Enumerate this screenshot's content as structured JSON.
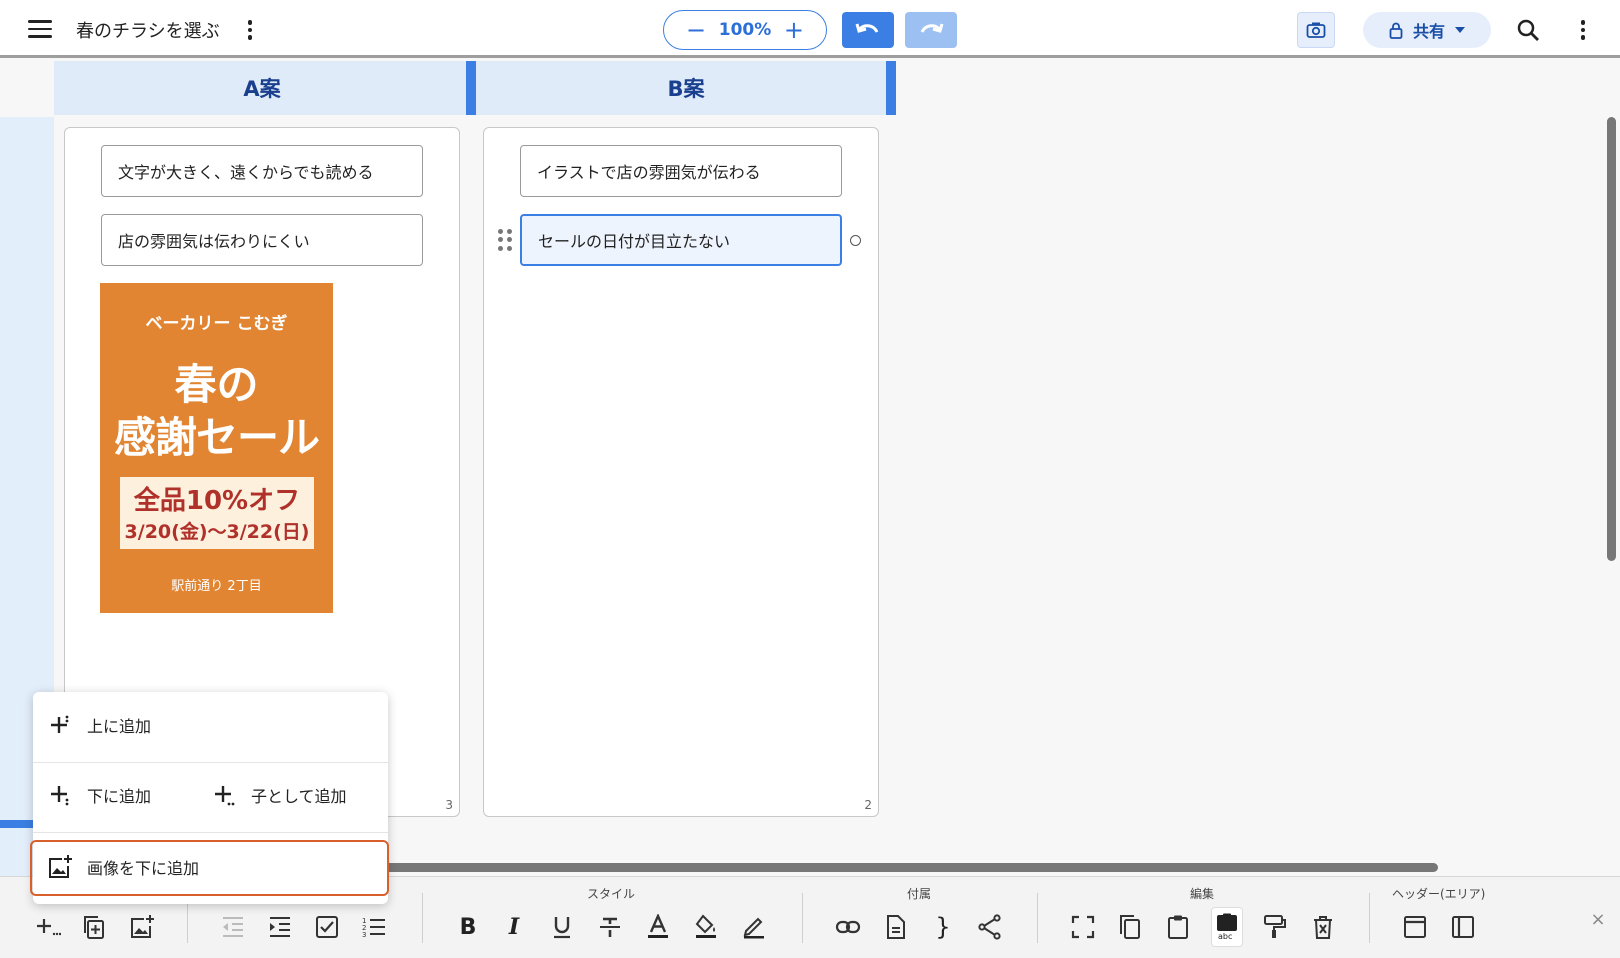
{
  "header": {
    "doc_title": "春のチラシを選ぶ",
    "zoom": "100%",
    "zoom_minus": "−",
    "zoom_plus": "+",
    "share_label": "共有"
  },
  "columns": [
    {
      "title": "A案",
      "cards": [
        "文字が大きく、遠くからでも読める",
        "店の雰囲気は伝わりにくい"
      ],
      "count": "3"
    },
    {
      "title": "B案",
      "cards": [
        "イラストで店の雰囲気が伝わる",
        "セールの日付が目立たない"
      ],
      "count": "2"
    }
  ],
  "flyer": {
    "shop": "ベーカリー こむぎ",
    "line1": "春の",
    "line2": "感謝セール",
    "promo1": "全品10%オフ",
    "promo2": "3/20(金)〜3/22(日)",
    "address": "駅前通り 2丁目"
  },
  "popup": {
    "add_above": "上に追加",
    "add_below": "下に追加",
    "add_child": "子として追加",
    "add_image_below": "画像を下に追加"
  },
  "toolbar": {
    "style_label": "スタイル",
    "attach_label": "付属",
    "edit_label": "編集",
    "header_label": "ヘッダー(エリア)",
    "close": "×"
  },
  "colors": {
    "accent": "#3b7fe4",
    "flyer_bg": "#e18533",
    "highlight": "#d9602c"
  }
}
